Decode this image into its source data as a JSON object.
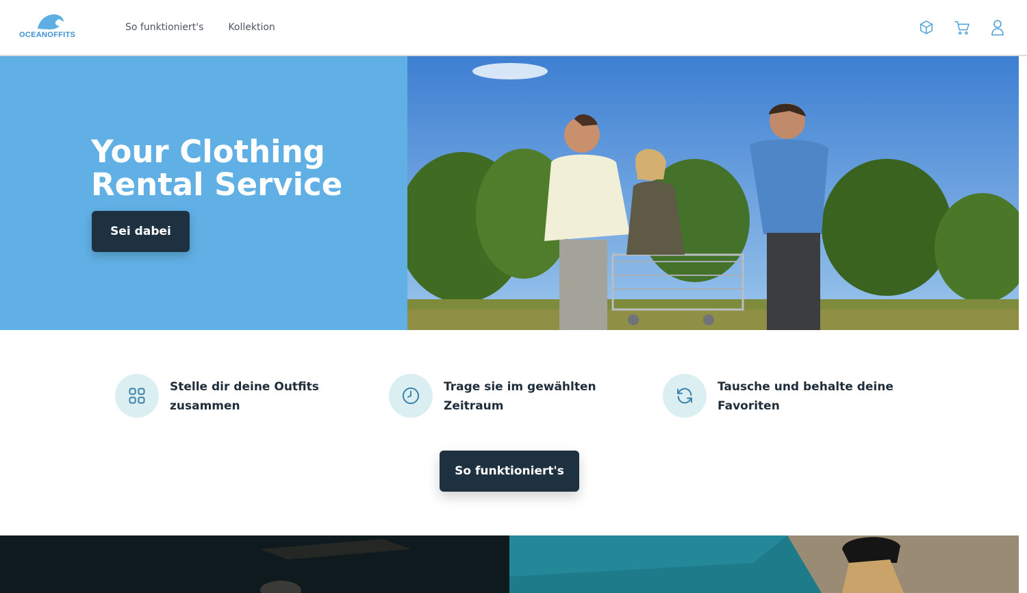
{
  "header": {
    "logo_text": "OCEANOFFITS",
    "nav": [
      "So funktioniert's",
      "Kollektion"
    ],
    "icons": [
      "box-icon",
      "cart-icon",
      "user-icon"
    ]
  },
  "hero": {
    "title_line1": "Your Clothing",
    "title_line2": "Rental Service",
    "cta_label": "Sei dabei",
    "photo_description_icon": "hero-photo"
  },
  "features": [
    {
      "icon": "grid-icon",
      "line1": "Stelle dir deine Outfits",
      "line2": "zusammen"
    },
    {
      "icon": "clock-icon",
      "line1": "Trage sie im gewählten",
      "line2": "Zeitraum"
    },
    {
      "icon": "refresh-icon",
      "line1": "Tausche und behalte deine",
      "line2": "Favoriten"
    }
  ],
  "how_it_works_label": "So funktioniert's",
  "colors": {
    "accent": "#60b0e5",
    "dark_button": "#1e3140",
    "icon_circle": "#dbeff2",
    "icon_stroke": "#3a7fa6"
  }
}
